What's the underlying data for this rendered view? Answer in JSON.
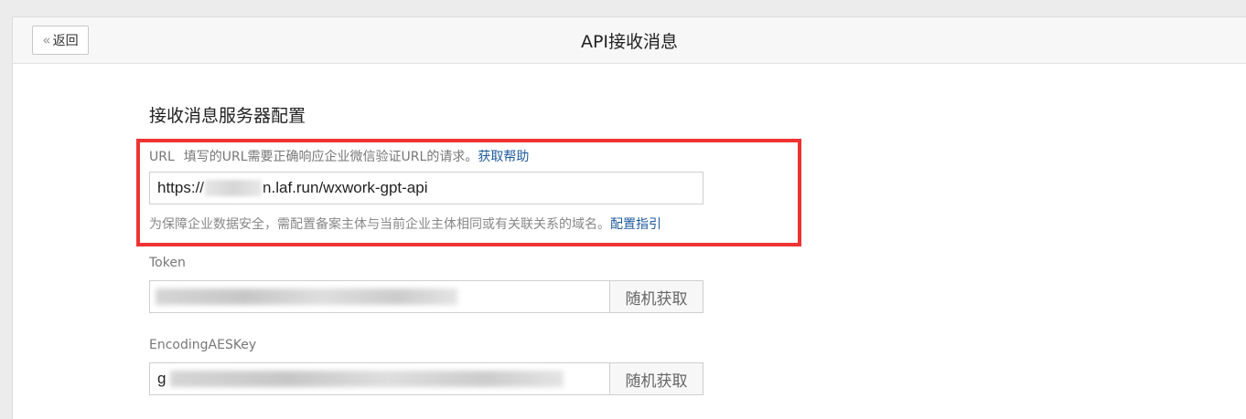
{
  "header": {
    "back_label": "返回",
    "back_icon": "double-chevron-left-icon",
    "title": "API接收消息"
  },
  "section": {
    "title": "接收消息服务器配置"
  },
  "url_field": {
    "label": "URL",
    "hint": "填写的URL需要正确响应企业微信验证URL的请求。",
    "help_link": "获取帮助",
    "value_prefix": "https://",
    "value_suffix": "n.laf.run/wxwork-gpt-api",
    "note": "为保障企业数据安全，需配置备案主体与当前企业主体相同或有关联关系的域名。",
    "note_link": "配置指引"
  },
  "token_field": {
    "label": "Token",
    "random_button": "随机获取"
  },
  "aes_field": {
    "label": "EncodingAESKey",
    "value_prefix": "g",
    "random_button": "随机获取"
  },
  "colors": {
    "highlight": "#ee3333",
    "link": "#1f5b9e"
  }
}
